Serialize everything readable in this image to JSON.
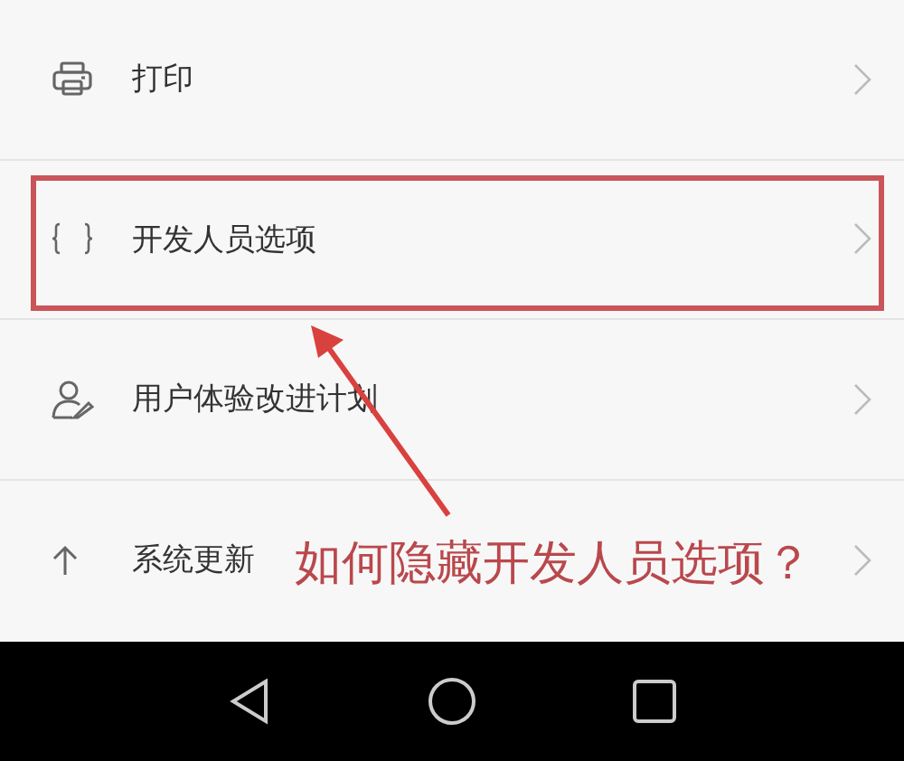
{
  "settings_items": [
    {
      "kind": "printer",
      "label": "打印",
      "highlighted": false
    },
    {
      "kind": "braces",
      "label": "开发人员选项",
      "highlighted": true
    },
    {
      "kind": "user",
      "label": "用户体验改进计划",
      "highlighted": false
    },
    {
      "kind": "arrow-up",
      "label": "系统更新",
      "highlighted": false
    }
  ],
  "annotation": {
    "text": "如何隐藏开发人员选项？"
  }
}
